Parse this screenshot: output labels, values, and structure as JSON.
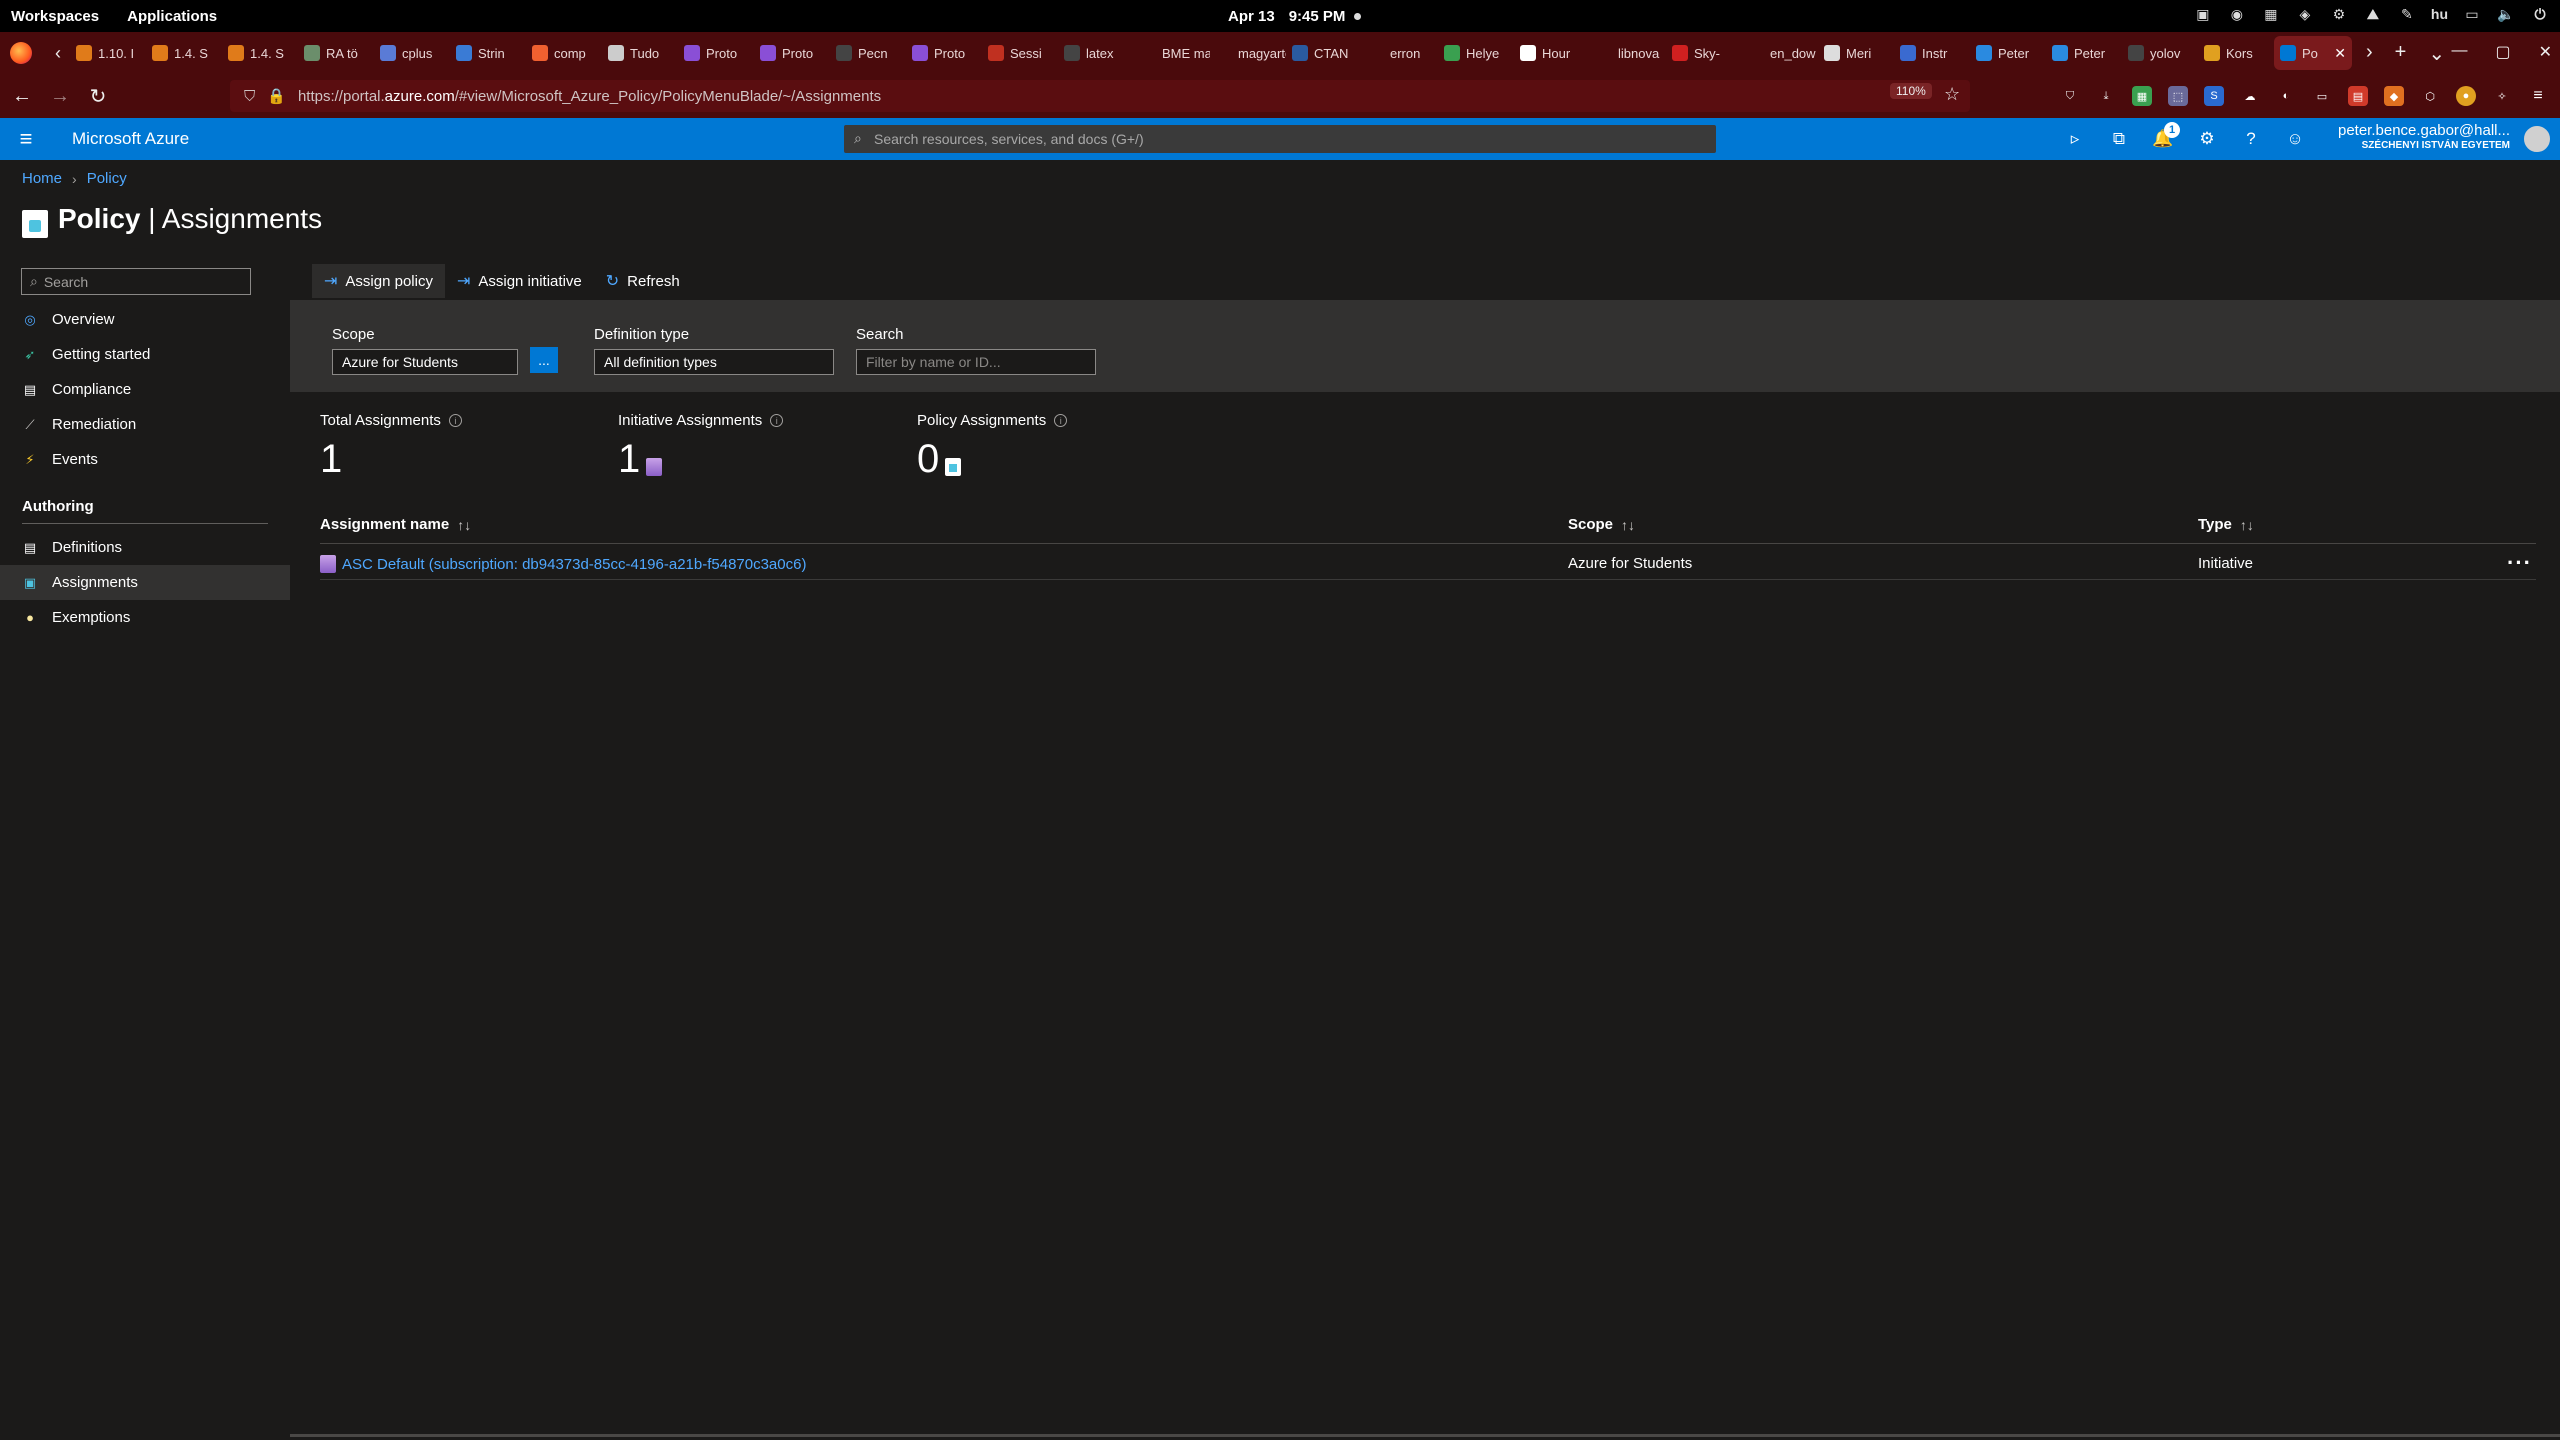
{
  "system_bar": {
    "workspaces": "Workspaces",
    "applications": "Applications",
    "date": "Apr 13",
    "time": "9:45 PM",
    "lang": "hu"
  },
  "browser": {
    "tabs": [
      {
        "label": "1.10. I",
        "color": "#e07b1a"
      },
      {
        "label": "1.4. S",
        "color": "#e07b1a"
      },
      {
        "label": "1.4. S",
        "color": "#e07b1a"
      },
      {
        "label": "RA tö",
        "color": "#6b8e6b"
      },
      {
        "label": "cplus",
        "color": "#5a7bd6"
      },
      {
        "label": "Strin",
        "color": "#3a7bd5"
      },
      {
        "label": "comp",
        "color": "#f06030"
      },
      {
        "label": "Tudo",
        "color": "#cccccc"
      },
      {
        "label": "Proto",
        "color": "#8a4fd6"
      },
      {
        "label": "Proto",
        "color": "#8a4fd6"
      },
      {
        "label": "Pecn",
        "color": "#444444"
      },
      {
        "label": "Proto",
        "color": "#8a4fd6"
      },
      {
        "label": "Sessi",
        "color": "#c03020"
      },
      {
        "label": "latex",
        "color": "#444444"
      },
      {
        "label": "BME mat",
        "color": "#4a0a0c"
      },
      {
        "label": "magyarto",
        "color": "#4a0a0c"
      },
      {
        "label": "CTAN",
        "color": "#2a5aa0"
      },
      {
        "label": "erron",
        "color": "#4a0a0c"
      },
      {
        "label": "Helye",
        "color": "#3aa050"
      },
      {
        "label": "Hour",
        "color": "#ffffff"
      },
      {
        "label": "libnova",
        "color": "#4a0a0c"
      },
      {
        "label": "Sky-",
        "color": "#d02020"
      },
      {
        "label": "en_dow",
        "color": "#4a0a0c"
      },
      {
        "label": "Meri",
        "color": "#dddddd"
      },
      {
        "label": "Instr",
        "color": "#3a6ad0"
      },
      {
        "label": "Peter",
        "color": "#2a8ae0"
      },
      {
        "label": "Peter",
        "color": "#2a8ae0"
      },
      {
        "label": "yolov",
        "color": "#444444"
      },
      {
        "label": "Kors",
        "color": "#e0a020"
      },
      {
        "label": "Po",
        "color": "#0078d4",
        "active": true
      }
    ],
    "url_prefix": "https://portal.",
    "url_host": "azure.com",
    "url_path": "/#view/Microsoft_Azure_Policy/PolicyMenuBlade/~/Assignments",
    "zoom": "110%"
  },
  "azure": {
    "brand": "Microsoft Azure",
    "search_placeholder": "Search resources, services, and docs (G+/)",
    "notification_count": "1",
    "account_email": "peter.bence.gabor@hall...",
    "account_directory": "SZÉCHENYI ISTVÁN EGYETEM"
  },
  "breadcrumb": {
    "home": "Home",
    "policy": "Policy"
  },
  "page": {
    "title_bold": "Policy",
    "title_rest": "| Assignments"
  },
  "sidebar": {
    "search_placeholder": "Search",
    "items": [
      {
        "label": "Overview",
        "icon": "overview-icon"
      },
      {
        "label": "Getting started",
        "icon": "rocket-icon"
      },
      {
        "label": "Compliance",
        "icon": "compliance-icon"
      },
      {
        "label": "Remediation",
        "icon": "remediation-icon"
      },
      {
        "label": "Events",
        "icon": "lightning-icon"
      }
    ],
    "section_authoring": "Authoring",
    "authoring_items": [
      {
        "label": "Definitions",
        "icon": "definitions-icon"
      },
      {
        "label": "Assignments",
        "icon": "assignments-icon",
        "active": true
      },
      {
        "label": "Exemptions",
        "icon": "exemptions-icon"
      }
    ]
  },
  "commands": {
    "assign_policy": "Assign policy",
    "assign_initiative": "Assign initiative",
    "refresh": "Refresh"
  },
  "filters": {
    "scope_label": "Scope",
    "scope_value": "Azure for Students",
    "scope_button": "...",
    "deftype_label": "Definition type",
    "deftype_value": "All definition types",
    "search_label": "Search",
    "search_placeholder": "Filter by name or ID..."
  },
  "summary": {
    "total_label": "Total Assignments",
    "total_value": "1",
    "initiative_label": "Initiative Assignments",
    "initiative_value": "1",
    "policy_label": "Policy Assignments",
    "policy_value": "0"
  },
  "table": {
    "col_name": "Assignment name",
    "col_scope": "Scope",
    "col_type": "Type",
    "rows": [
      {
        "name": "ASC Default (subscription: db94373d-85cc-4196-a21b-f54870c3a0c6)",
        "scope": "Azure for Students",
        "type": "Initiative"
      }
    ]
  }
}
